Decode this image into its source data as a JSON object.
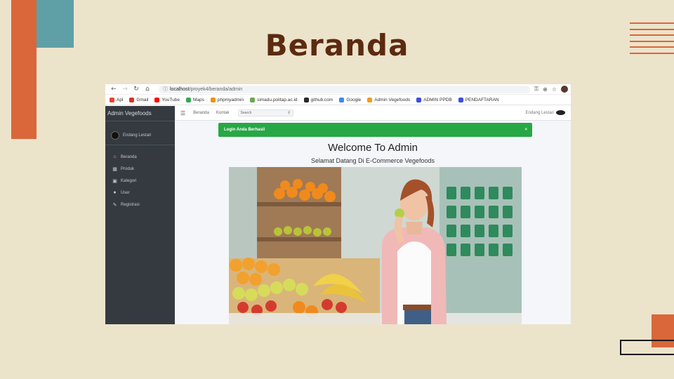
{
  "slide": {
    "title": "Beranda"
  },
  "browser": {
    "url_host": "localhost",
    "url_path": "/proyek4/beranda/admin",
    "nav": {
      "back": "←",
      "forward": "→",
      "reload": "↻",
      "home": "⌂"
    },
    "bookmarks": [
      {
        "label": "Apl",
        "icon": "apps-grid-icon",
        "color": "#ea4335"
      },
      {
        "label": "Gmail",
        "icon": "gmail-icon",
        "color": "#d93025"
      },
      {
        "label": "YouTube",
        "icon": "youtube-icon",
        "color": "#ff0000"
      },
      {
        "label": "Maps",
        "icon": "maps-pin-icon",
        "color": "#34a853"
      },
      {
        "label": "phpmyadmin",
        "icon": "phpmyadmin-icon",
        "color": "#f29111"
      },
      {
        "label": "simadu.politap.ac.id",
        "icon": "globe-icon",
        "color": "#6aa84f"
      },
      {
        "label": "github.com",
        "icon": "github-icon",
        "color": "#24292e"
      },
      {
        "label": "Google",
        "icon": "google-icon",
        "color": "#4285f4"
      },
      {
        "label": "Admin Vegefoods",
        "icon": "vegefoods-icon",
        "color": "#f09b20"
      },
      {
        "label": "ADMIN PPDB",
        "icon": "ppdb-icon",
        "color": "#3c4fe0"
      },
      {
        "label": "PENDAFTARAN",
        "icon": "ppdb-icon",
        "color": "#3c4fe0"
      }
    ]
  },
  "sidebar": {
    "brand": "Admin Vegefoods",
    "user": "Endang Lestari",
    "items": [
      {
        "label": "Beranda",
        "icon": "home-icon",
        "glyph": "⌂"
      },
      {
        "label": "Produk",
        "icon": "calendar-icon",
        "glyph": "▦"
      },
      {
        "label": "Kategori",
        "icon": "image-icon",
        "glyph": "▣"
      },
      {
        "label": "User",
        "icon": "user-icon",
        "glyph": "●"
      },
      {
        "label": "Registrasi",
        "icon": "edit-icon",
        "glyph": "✎"
      }
    ]
  },
  "topnav": {
    "links": [
      "Beranda",
      "Kontak"
    ],
    "search_placeholder": "Search",
    "user": "Endang Lestari"
  },
  "alert": {
    "text": "Login Anda Berhasil",
    "close": "×",
    "color": "#28a745"
  },
  "content": {
    "welcome": "Welcome To Admin",
    "subtitle": "Selamat Datang Di E-Commerce Vegefoods"
  }
}
